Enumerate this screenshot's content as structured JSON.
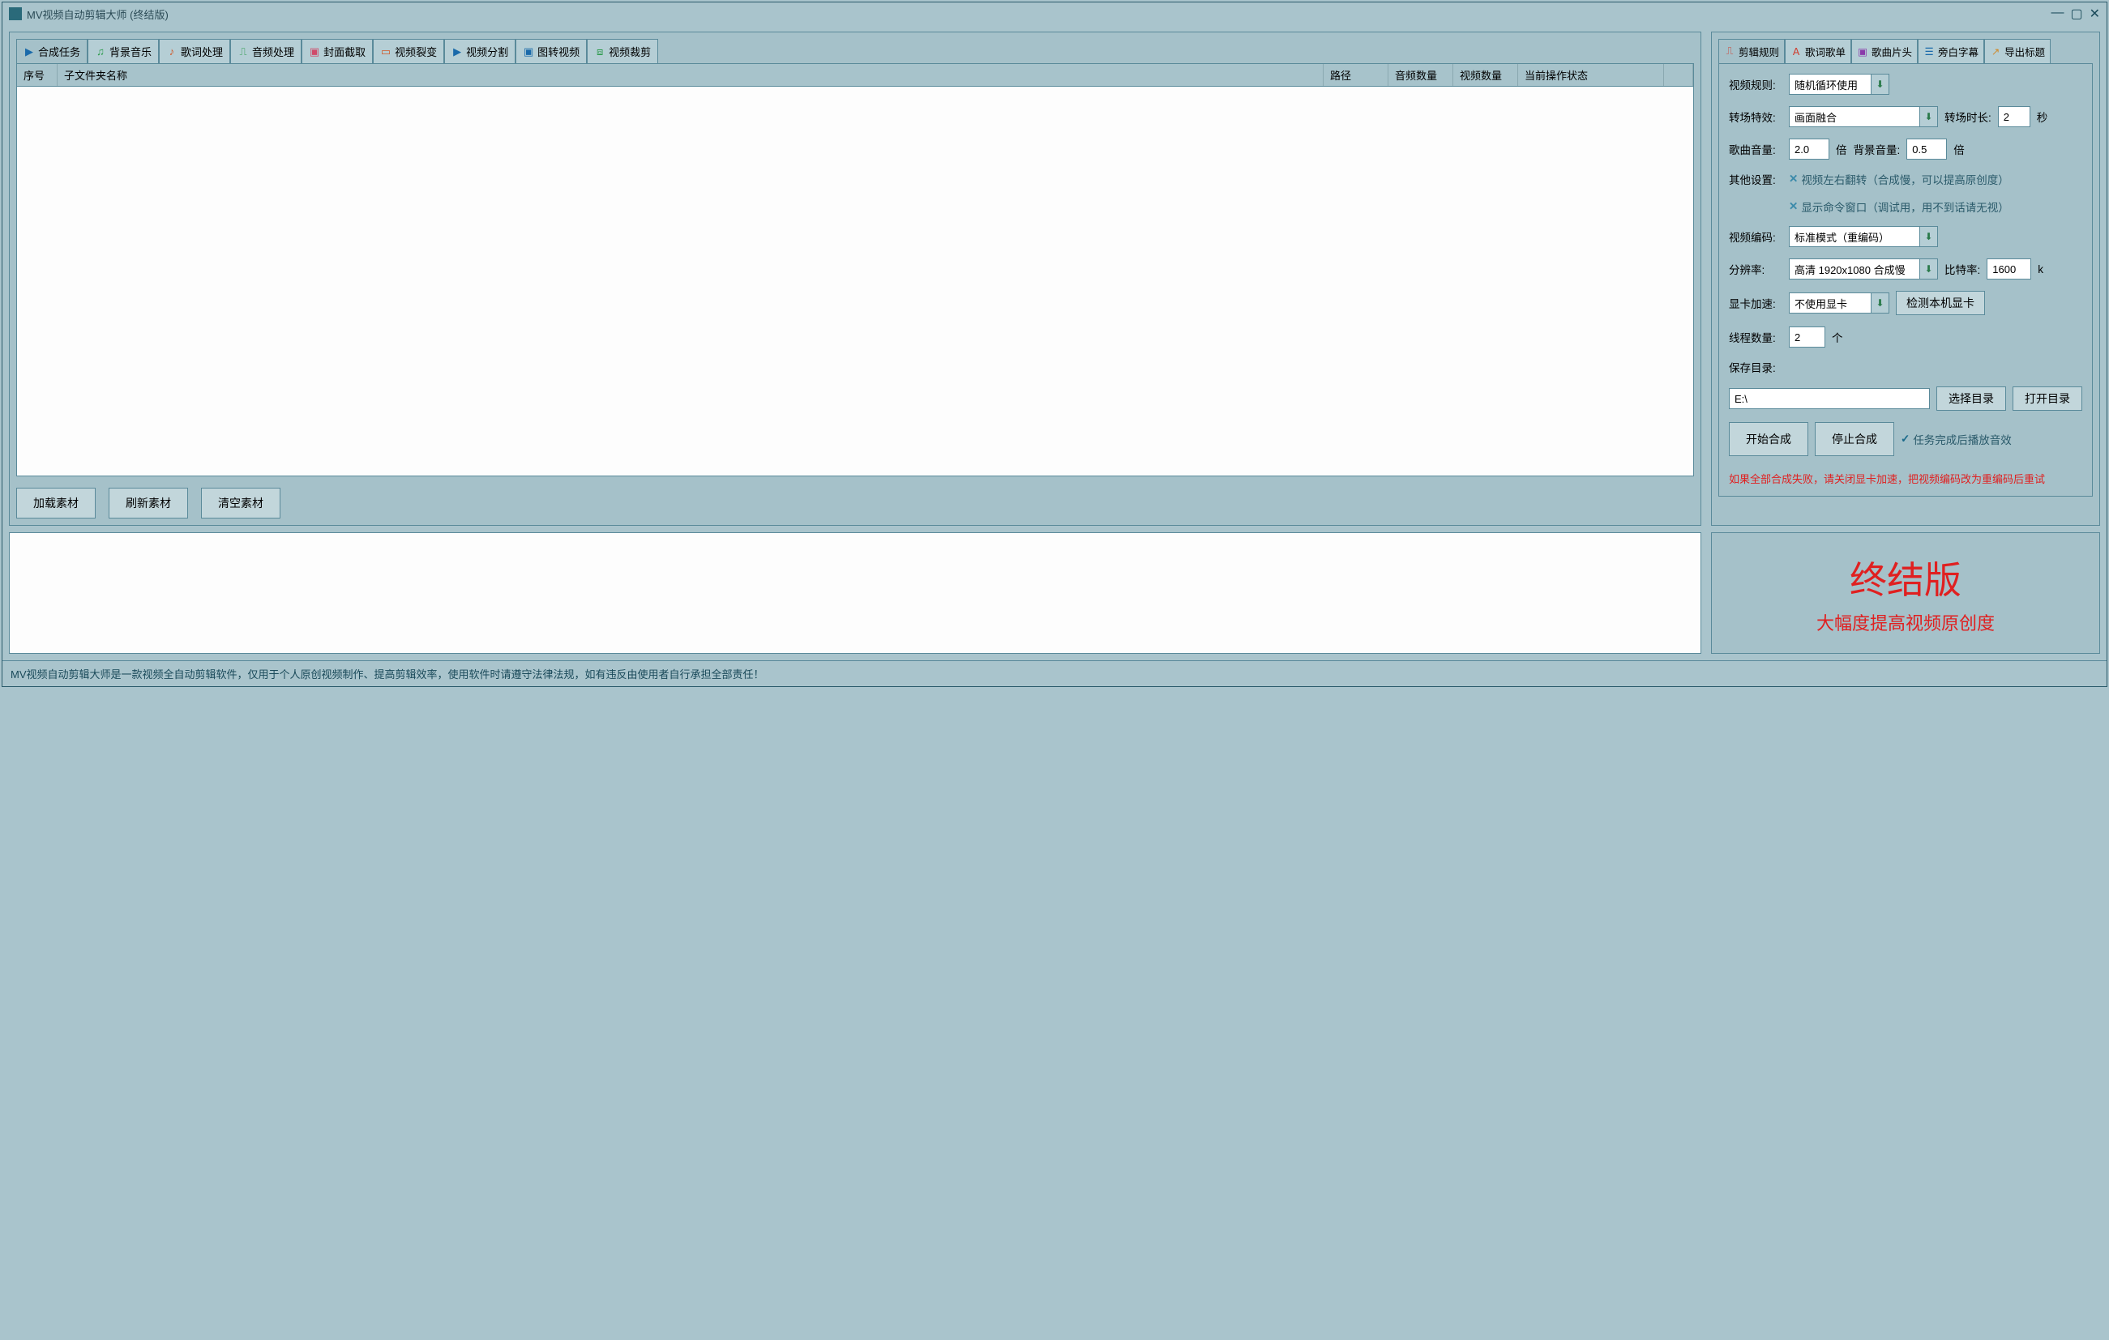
{
  "title": "MV视频自动剪辑大师  (终结版)",
  "left_tabs": [
    "合成任务",
    "背景音乐",
    "歌词处理",
    "音频处理",
    "封面截取",
    "视频裂变",
    "视频分割",
    "图转视频",
    "视频裁剪"
  ],
  "table_headers": [
    "序号",
    "子文件夹名称",
    "路径",
    "音频数量",
    "视频数量",
    "当前操作状态"
  ],
  "buttons": {
    "load": "加载素材",
    "refresh": "刷新素材",
    "clear": "清空素材"
  },
  "right_tabs": [
    "剪辑规则",
    "歌词歌单",
    "歌曲片头",
    "旁白字幕",
    "导出标题"
  ],
  "form": {
    "video_rule_label": "视频规则:",
    "video_rule": "随机循环使用",
    "transition_label": "转场特效:",
    "transition": "画面融合",
    "transition_dur_label": "转场时长:",
    "transition_dur": "2",
    "transition_dur_unit": "秒",
    "song_vol_label": "歌曲音量:",
    "song_vol": "2.0",
    "song_vol_unit": "倍",
    "bg_vol_label": "背景音量:",
    "bg_vol": "0.5",
    "bg_vol_unit": "倍",
    "other_label": "其他设置:",
    "flip": "视频左右翻转（合成慢，可以提高原创度）",
    "show_cmd": "显示命令窗口（调试用，用不到话请无视）",
    "encode_label": "视频编码:",
    "encode": "标准模式（重编码）",
    "res_label": "分辨率:",
    "res": "高清 1920x1080 合成慢",
    "bitrate_label": "比特率:",
    "bitrate": "1600",
    "bitrate_unit": "k",
    "gpu_label": "显卡加速:",
    "gpu": "不使用显卡",
    "detect_gpu": "检测本机显卡",
    "threads_label": "线程数量:",
    "threads": "2",
    "threads_unit": "个",
    "save_label": "保存目录:",
    "save_path": "E:\\",
    "choose_dir": "选择目录",
    "open_dir": "打开目录",
    "start": "开始合成",
    "stop": "停止合成",
    "play_sound": "任务完成后播放音效",
    "warn": "如果全部合成失败，请关闭显卡加速，把视频编码改为重编码后重试"
  },
  "banner": {
    "big": "终结版",
    "sub": "大幅度提高视频原创度"
  },
  "footer": "MV视频自动剪辑大师是一款视频全自动剪辑软件，仅用于个人原创视频制作、提高剪辑效率，使用软件时请遵守法律法规，如有违反由使用者自行承担全部责任！"
}
